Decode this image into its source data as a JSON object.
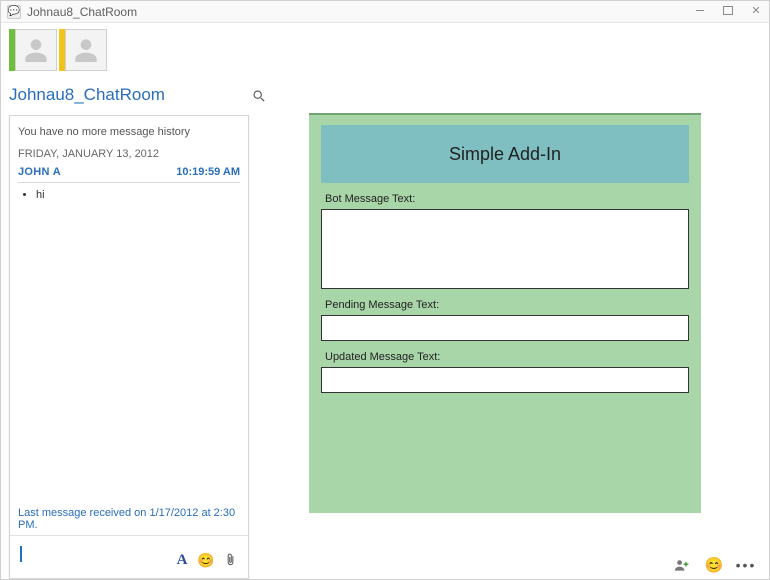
{
  "window": {
    "title": "Johnau8_ChatRoom"
  },
  "header": {
    "room_name": "Johnau8_ChatRoom"
  },
  "chat": {
    "history_notice": "You have no more message history",
    "date": "FRIDAY, JANUARY 13, 2012",
    "sender": "JOHN A",
    "time": "10:19:59 AM",
    "message": "hi",
    "last_received": "Last message received on 1/17/2012 at 2:30 PM."
  },
  "addin": {
    "title": "Simple Add-In",
    "labels": {
      "bot": "Bot Message Text:",
      "pending": "Pending Message Text:",
      "updated": "Updated Message Text:"
    },
    "values": {
      "bot": "",
      "pending": "",
      "updated": ""
    }
  }
}
